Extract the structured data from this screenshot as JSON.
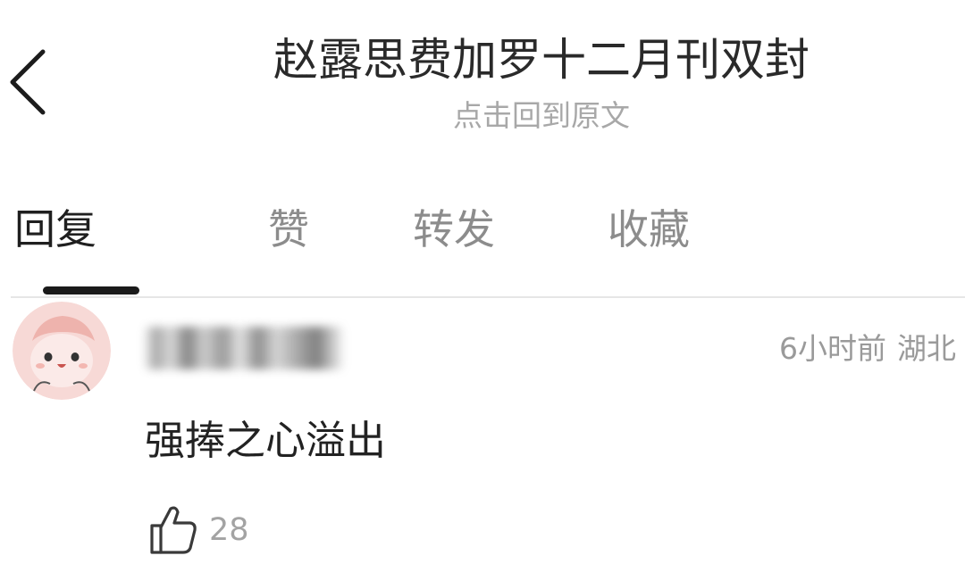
{
  "header": {
    "title": "赵露思费加罗十二月刊双封",
    "subtitle": "点击回到原文"
  },
  "tabs": [
    {
      "label": "回复",
      "active": true
    },
    {
      "label": "赞",
      "active": false
    },
    {
      "label": "转发",
      "active": false
    },
    {
      "label": "收藏",
      "active": false
    }
  ],
  "comment": {
    "username_blurred": true,
    "time": "6小时前",
    "location": "湖北",
    "text": "强捧之心溢出",
    "likes": "28"
  },
  "icons": {
    "back": "chevron-left-icon",
    "like": "thumbs-up-icon"
  },
  "colors": {
    "active_tab": "#1f1f1f",
    "inactive_tab": "#8c8c8c",
    "meta_text": "#9a9a9a",
    "avatar_bg": "#f7d9d6"
  }
}
